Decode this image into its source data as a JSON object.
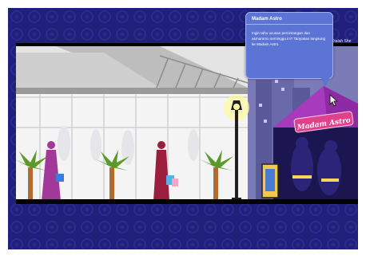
{
  "header": {
    "right_text": "..., Dialah She"
  },
  "tooltip": {
    "title": "Madam Astro",
    "body": "Ingin tahu ucusan percintangan dan asmaramu seminggu ini? Tanyakan langsung ke Madam Astro."
  },
  "booth": {
    "sign": "Madam Astro"
  },
  "colors": {
    "background": "#20207a",
    "pattern": "#2b2b8e",
    "tooltip_bg": "#5c74d4",
    "tent": "#8e2aa3",
    "sign_bg": "#e0418c",
    "shopper_1": "#a3389b",
    "shopper_2": "#9b1f3c",
    "city": "#5a5a9a",
    "street_lamp": "#1f1f1f"
  },
  "icons": [
    "logo-icon",
    "cursor-icon",
    "street-lamp-icon",
    "palm-tree-icon",
    "shopping-bag-icon"
  ]
}
